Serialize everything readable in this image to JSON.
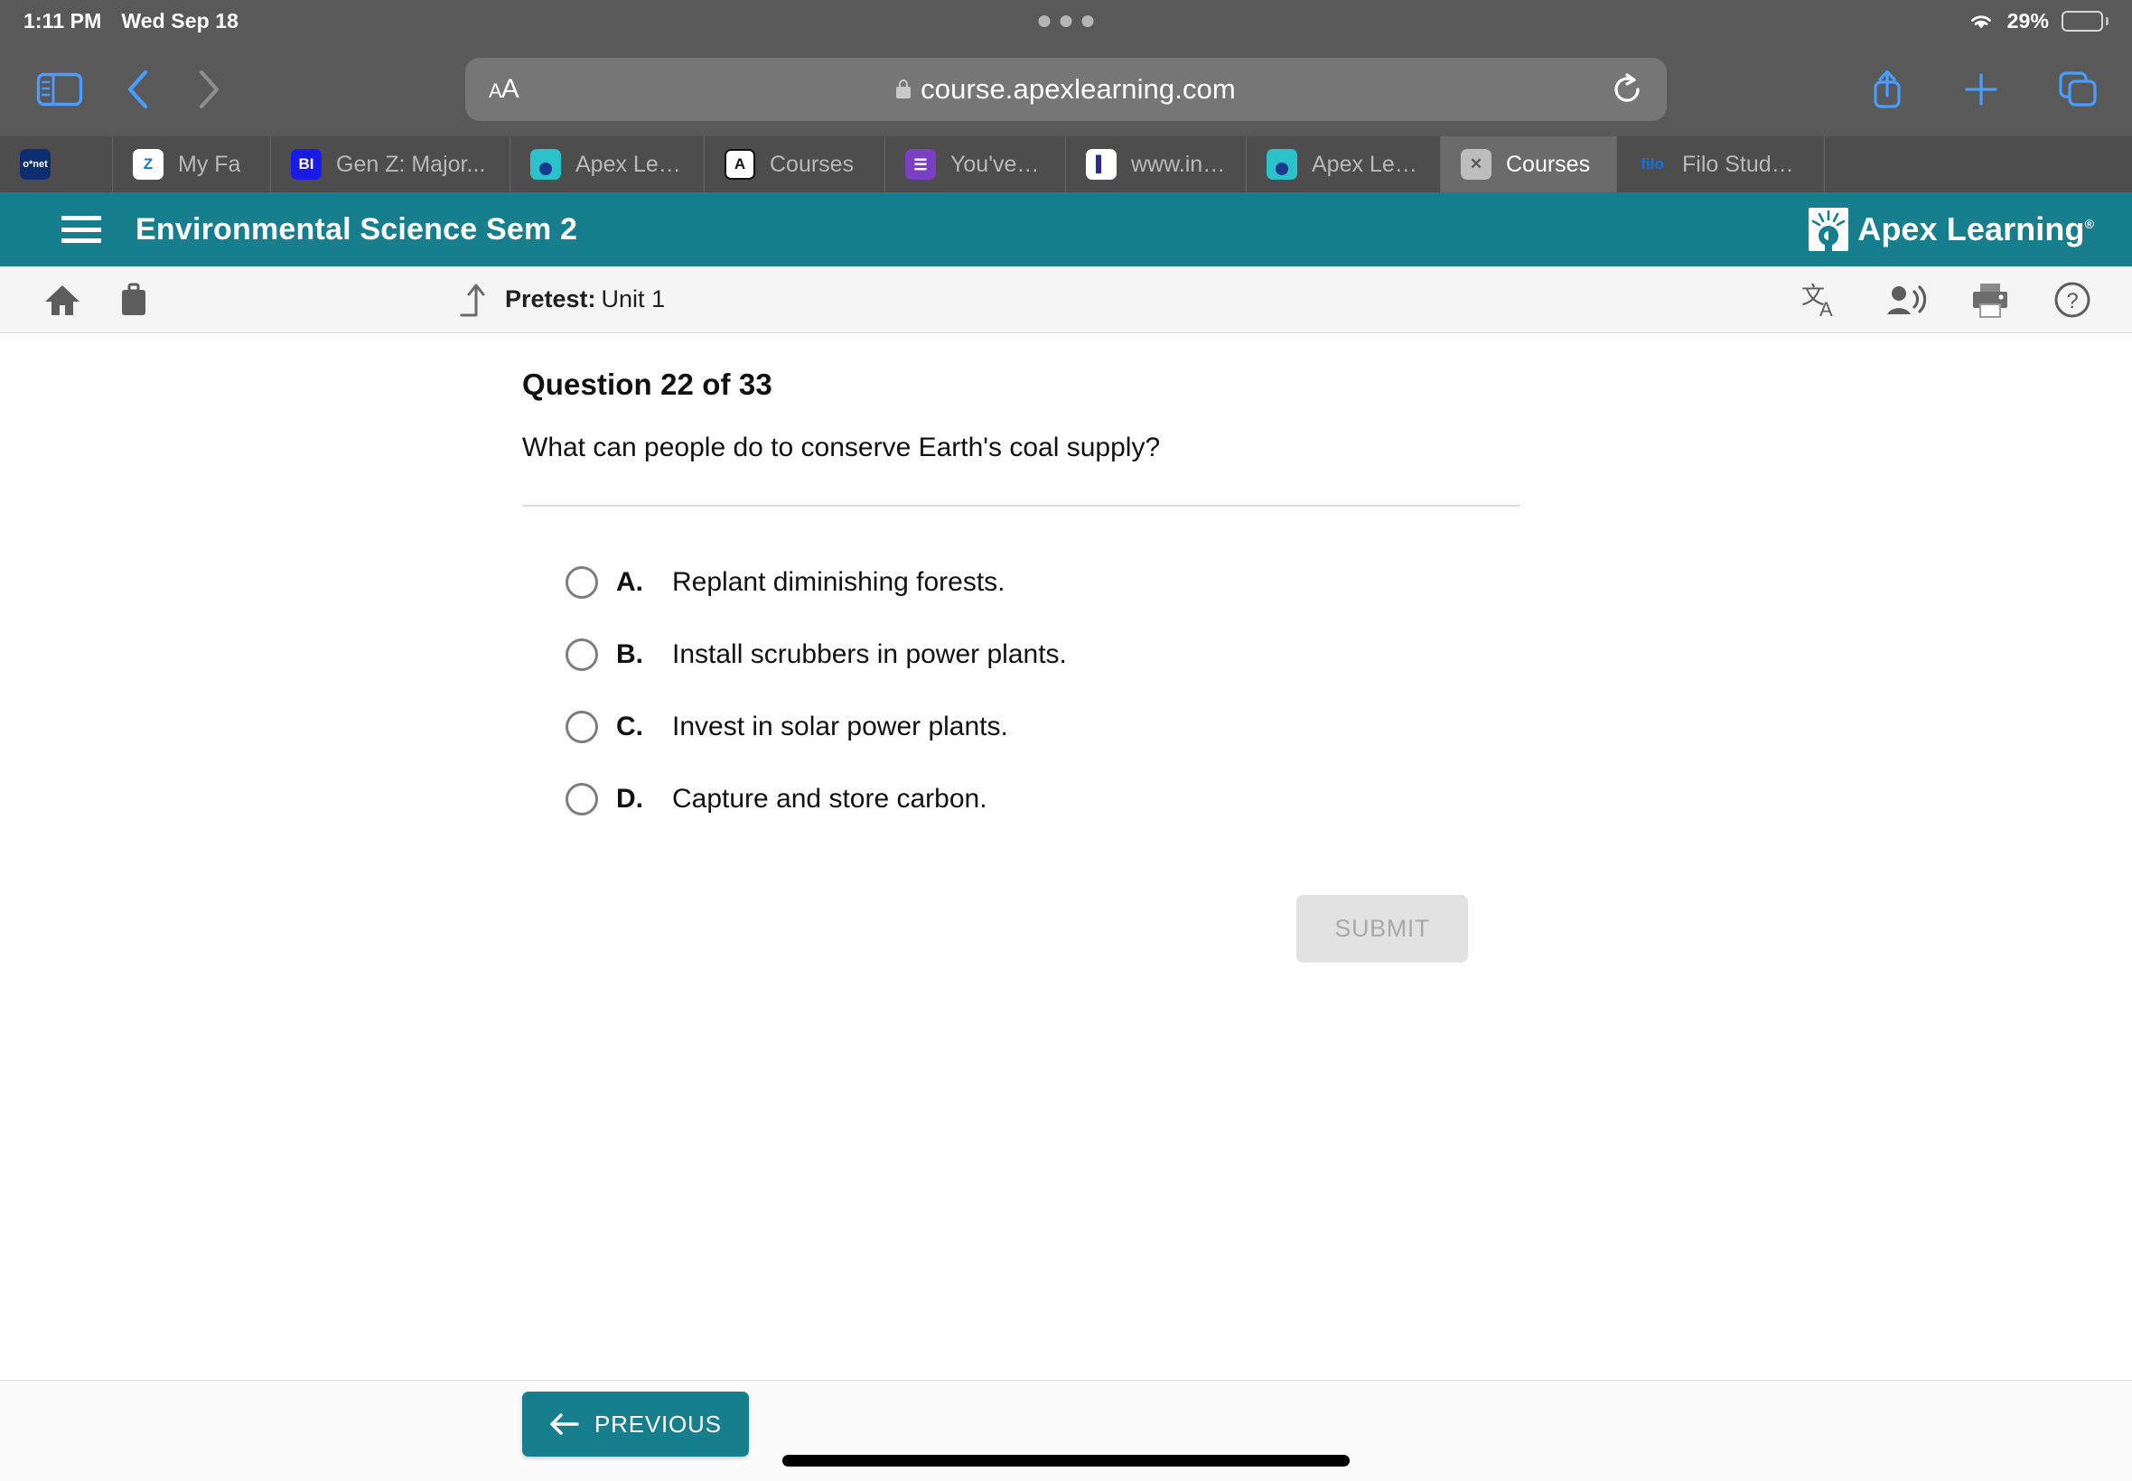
{
  "status_bar": {
    "time": "1:11 PM",
    "date": "Wed Sep 18",
    "battery_percent": "29%",
    "wifi_icon": "wifi-icon",
    "battery_icon": "battery-icon"
  },
  "browser": {
    "sidebar_icon": "sidebar-toggle-icon",
    "back_icon": "chevron-left-icon",
    "forward_icon": "chevron-right-icon",
    "reader_label": "AA",
    "url": "course.apexlearning.com",
    "lock_icon": "lock-icon",
    "reload_icon": "reload-icon",
    "share_icon": "share-icon",
    "new_tab_icon": "plus-icon",
    "tabs_icon": "tabs-overview-icon",
    "tabs": [
      {
        "label": "",
        "favicon": "onet-favicon",
        "active": false
      },
      {
        "label": "My Fa",
        "favicon": "zillow-favicon",
        "active": false
      },
      {
        "label": "Gen Z: Major...",
        "favicon": "businessinsider-favicon",
        "active": false
      },
      {
        "label": "Apex Learning",
        "favicon": "apex-favicon",
        "active": false
      },
      {
        "label": "Courses",
        "favicon": "apex-a-favicon",
        "active": false
      },
      {
        "label": "You've alrea...",
        "favicon": "list-favicon",
        "active": false
      },
      {
        "label": "www.in.gov/...",
        "favicon": "indiana-favicon",
        "active": false
      },
      {
        "label": "Apex Learning",
        "favicon": "apex-favicon",
        "active": false
      },
      {
        "label": "Courses",
        "favicon": "close-x-favicon",
        "active": true
      },
      {
        "label": "Filo Student:...",
        "favicon": "filo-favicon",
        "active": false
      }
    ]
  },
  "app_header": {
    "menu_icon": "hamburger-menu-icon",
    "course_title": "Environmental Science Sem 2",
    "brand_name": "Apex Learning",
    "brand_trademark": "®",
    "background_color": "#167e8d"
  },
  "sub_toolbar": {
    "home_icon": "home-icon",
    "briefcase_icon": "briefcase-icon",
    "level_up_icon": "level-up-arrow-icon",
    "activity_type": "Pretest:",
    "activity_unit": "Unit 1",
    "translate_icon": "translate-icon",
    "read_aloud_icon": "read-aloud-icon",
    "print_icon": "print-icon",
    "help_icon": "help-circle-icon"
  },
  "question": {
    "heading": "Question 22 of 33",
    "number": 22,
    "total": 33,
    "prompt": "What can people do to conserve Earth's coal supply?",
    "choices": [
      {
        "key": "A.",
        "text": "Replant diminishing forests.",
        "selected": false
      },
      {
        "key": "B.",
        "text": "Install scrubbers in power plants.",
        "selected": false
      },
      {
        "key": "C.",
        "text": "Invest in solar power plants.",
        "selected": false
      },
      {
        "key": "D.",
        "text": "Capture and store carbon.",
        "selected": false
      }
    ],
    "submit_label": "SUBMIT",
    "submit_enabled": false
  },
  "bottom_bar": {
    "previous_label": "PREVIOUS",
    "previous_icon": "arrow-left-icon",
    "home_indicator": "home-indicator"
  }
}
